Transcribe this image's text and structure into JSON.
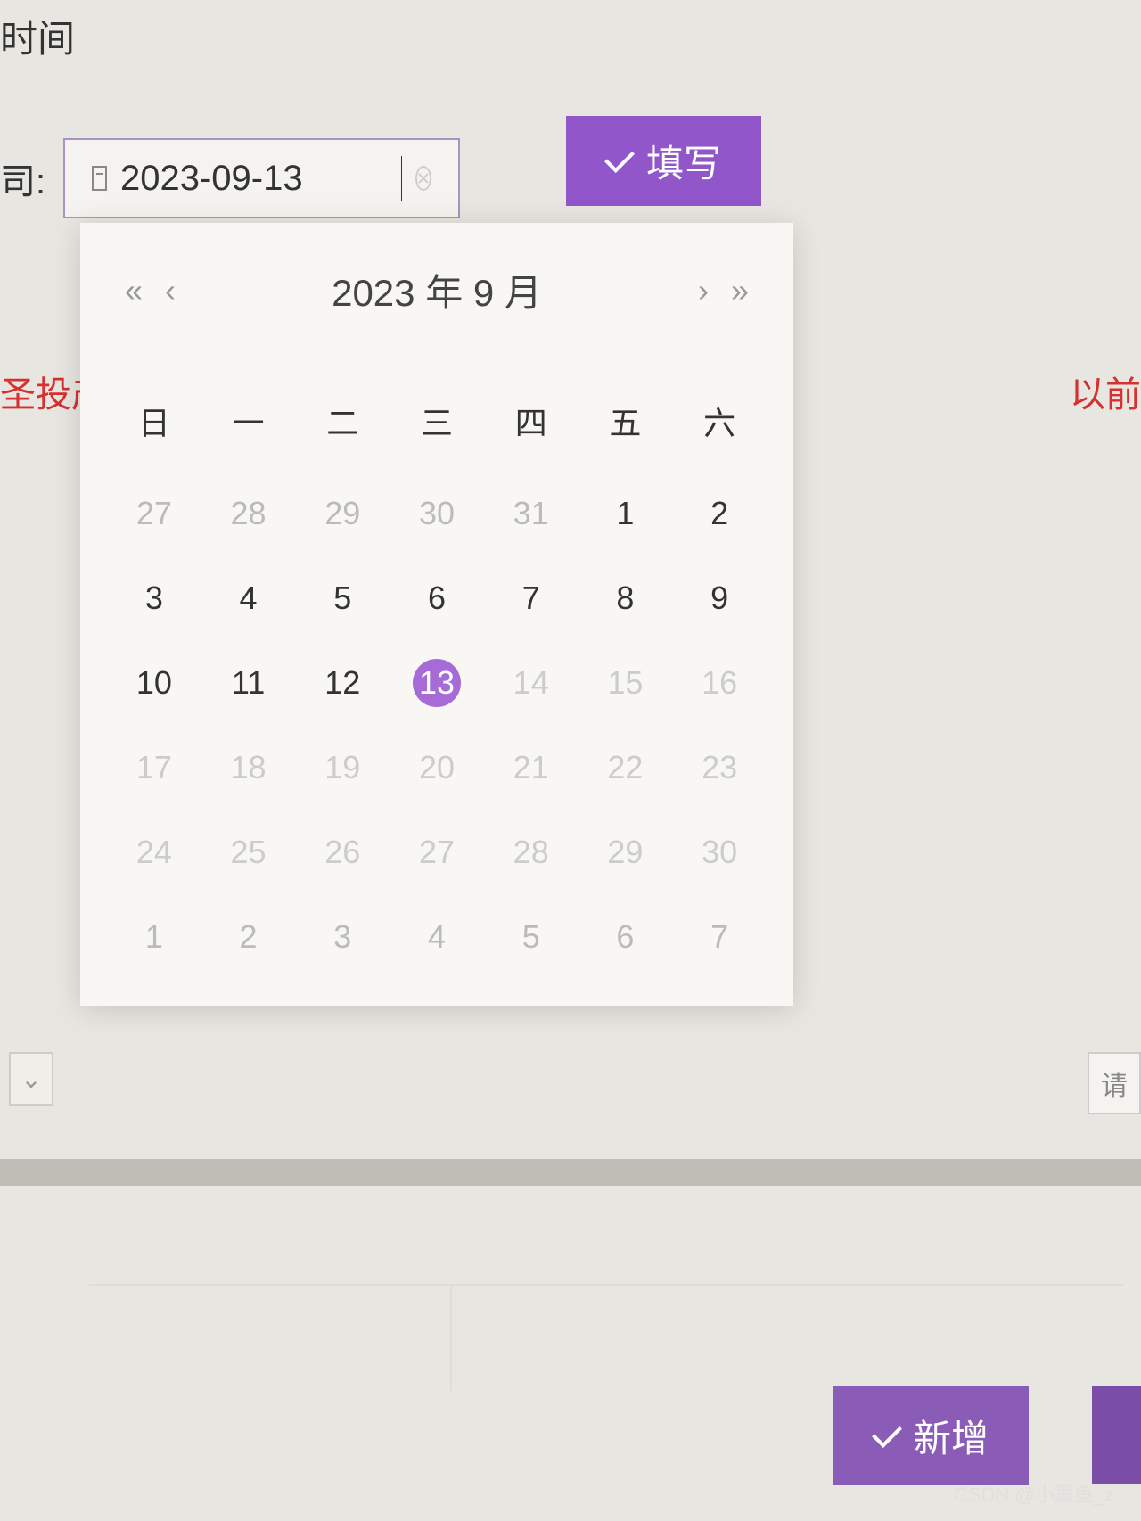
{
  "page": {
    "title": "时间"
  },
  "form": {
    "label": "司:",
    "date_value": "2023-09-13",
    "fill_button": "填写"
  },
  "calendar": {
    "year_month": "2023 年  9 月",
    "weekdays": [
      "日",
      "一",
      "二",
      "三",
      "四",
      "五",
      "六"
    ],
    "rows": [
      [
        {
          "d": "27",
          "type": "other"
        },
        {
          "d": "28",
          "type": "other"
        },
        {
          "d": "29",
          "type": "other"
        },
        {
          "d": "30",
          "type": "other"
        },
        {
          "d": "31",
          "type": "other"
        },
        {
          "d": "1",
          "type": "cur"
        },
        {
          "d": "2",
          "type": "cur"
        }
      ],
      [
        {
          "d": "3",
          "type": "cur"
        },
        {
          "d": "4",
          "type": "cur"
        },
        {
          "d": "5",
          "type": "cur"
        },
        {
          "d": "6",
          "type": "cur"
        },
        {
          "d": "7",
          "type": "cur"
        },
        {
          "d": "8",
          "type": "cur"
        },
        {
          "d": "9",
          "type": "cur"
        }
      ],
      [
        {
          "d": "10",
          "type": "cur"
        },
        {
          "d": "11",
          "type": "cur"
        },
        {
          "d": "12",
          "type": "cur"
        },
        {
          "d": "13",
          "type": "selected"
        },
        {
          "d": "14",
          "type": "disabled"
        },
        {
          "d": "15",
          "type": "disabled"
        },
        {
          "d": "16",
          "type": "disabled"
        }
      ],
      [
        {
          "d": "17",
          "type": "disabled"
        },
        {
          "d": "18",
          "type": "disabled"
        },
        {
          "d": "19",
          "type": "disabled"
        },
        {
          "d": "20",
          "type": "disabled"
        },
        {
          "d": "21",
          "type": "disabled"
        },
        {
          "d": "22",
          "type": "disabled"
        },
        {
          "d": "23",
          "type": "disabled"
        }
      ],
      [
        {
          "d": "24",
          "type": "disabled"
        },
        {
          "d": "25",
          "type": "disabled"
        },
        {
          "d": "26",
          "type": "disabled"
        },
        {
          "d": "27",
          "type": "disabled"
        },
        {
          "d": "28",
          "type": "disabled"
        },
        {
          "d": "29",
          "type": "disabled"
        },
        {
          "d": "30",
          "type": "disabled"
        }
      ],
      [
        {
          "d": "1",
          "type": "other"
        },
        {
          "d": "2",
          "type": "other"
        },
        {
          "d": "3",
          "type": "other"
        },
        {
          "d": "4",
          "type": "other"
        },
        {
          "d": "5",
          "type": "other"
        },
        {
          "d": "6",
          "type": "other"
        },
        {
          "d": "7",
          "type": "other"
        }
      ]
    ]
  },
  "background": {
    "left_red": "圣投产",
    "right_red": "以前",
    "right_box": "请"
  },
  "buttons": {
    "new": "新增"
  },
  "watermark": "CSDN @小墨鱼_z"
}
